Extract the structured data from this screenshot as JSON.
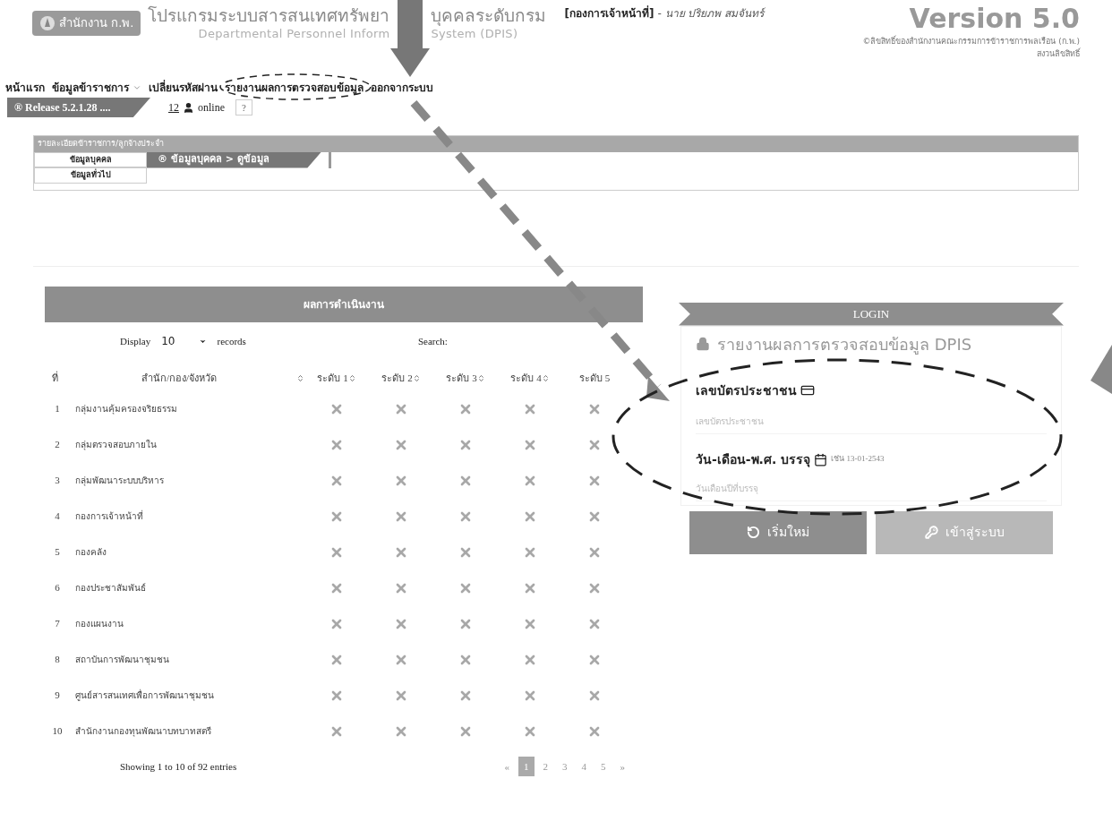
{
  "header": {
    "logo_text": "สำนักงาน ก.พ.",
    "title": [
      "โปรแกรมระบบสารสนเทศทรัพยา",
      "บุคคลระดับกรม"
    ],
    "subtitle": [
      "Departmental Personnel Inform",
      "System (DPIS)"
    ],
    "department": "[กองการเจ้าหน้าที่]",
    "user": "- นาย ปริยภพ สมจันทร์",
    "version": "Version 5.0",
    "copyright": "©ลิขสิทธิ์ของสำนักงานคณะกรรมการข้าราชการพลเรือน (ก.พ.)",
    "rights": "สงวนลิขสิทธิ์"
  },
  "nav": [
    {
      "label": "หน้าแรก",
      "dropdown": false
    },
    {
      "label": "ข้อมูลข้าราชการ",
      "dropdown": true
    },
    {
      "label": "เปลี่ยนรหัสผ่าน",
      "dropdown": false
    },
    {
      "label": "รายงานผลการตรวจสอบข้อมูล",
      "dropdown": false
    },
    {
      "label": "ออกจากระบบ",
      "dropdown": false
    }
  ],
  "release": "® Release 5.2.1.28 ....",
  "online_count": "12",
  "online_label": "online",
  "help": "?",
  "panel": {
    "title": "รายละเอียดข้าราชการ/ลูกจ้างประจำ",
    "menu": [
      "ข้อมูลบุคคล",
      "ข้อมูลทั่วไป"
    ],
    "breadcrumb": "® ข้อมูลบุคคล > ดูข้อมูล"
  },
  "table": {
    "title": "ผลการดำเนินงาน",
    "display_label": "Display",
    "page_size": "10",
    "records_label": "records",
    "search_label": "Search:",
    "columns": [
      {
        "label": "ที่",
        "sortable": false
      },
      {
        "label": "สำนัก/กอง/จังหวัด",
        "sortable": true
      },
      {
        "label": "ระดับ 1",
        "sortable": true
      },
      {
        "label": "ระดับ 2",
        "sortable": true
      },
      {
        "label": "ระดับ 3",
        "sortable": true
      },
      {
        "label": "ระดับ 4",
        "sortable": true
      },
      {
        "label": "ระดับ 5",
        "sortable": false
      }
    ],
    "rows": [
      {
        "no": "1",
        "name": "กลุ่มงานคุ้มครองจริยธรรม",
        "levels": [
          false,
          false,
          false,
          false,
          false
        ]
      },
      {
        "no": "2",
        "name": "กลุ่มตรวจสอบภายใน",
        "levels": [
          false,
          false,
          false,
          false,
          false
        ]
      },
      {
        "no": "3",
        "name": "กลุ่มพัฒนาระบบบริหาร",
        "levels": [
          false,
          false,
          false,
          false,
          false
        ]
      },
      {
        "no": "4",
        "name": "กองการเจ้าหน้าที่",
        "levels": [
          false,
          false,
          false,
          false,
          false
        ]
      },
      {
        "no": "5",
        "name": "กองคลัง",
        "levels": [
          false,
          false,
          false,
          false,
          false
        ]
      },
      {
        "no": "6",
        "name": "กองประชาสัมพันธ์",
        "levels": [
          false,
          false,
          false,
          false,
          false
        ]
      },
      {
        "no": "7",
        "name": "กองแผนงาน",
        "levels": [
          false,
          false,
          false,
          false,
          false
        ]
      },
      {
        "no": "8",
        "name": "สถาบันการพัฒนาชุมชน",
        "levels": [
          false,
          false,
          false,
          false,
          false
        ]
      },
      {
        "no": "9",
        "name": "ศูนย์สารสนเทศเพื่อการพัฒนาชุมชน",
        "levels": [
          false,
          false,
          false,
          false,
          false
        ]
      },
      {
        "no": "10",
        "name": "สำนักงานกองทุนพัฒนาบทบาทสตรี",
        "levels": [
          false,
          false,
          false,
          false,
          false
        ]
      }
    ],
    "info": "Showing 1 to 10 of 92 entries",
    "pagination": [
      {
        "label": "«",
        "selected": false
      },
      {
        "label": "1",
        "selected": true
      },
      {
        "label": "2",
        "selected": false
      },
      {
        "label": "3",
        "selected": false
      },
      {
        "label": "4",
        "selected": false
      },
      {
        "label": "5",
        "selected": false
      },
      {
        "label": "»",
        "selected": false
      }
    ]
  },
  "login": {
    "ribbon": "LOGIN",
    "title": "รายงานผลการตรวจสอบข้อมูล DPIS",
    "id_label": "เลขบัตรประชาชน",
    "id_placeholder": "เลขบัตรประชาชน",
    "date_label": "วัน-เดือน-พ.ศ. บรรจุ",
    "date_hint": "เช่น 13-01-2543",
    "date_placeholder": "วันเดือนปีที่บรรจุ",
    "reset_button": "เริ่มใหม่",
    "login_button": "เข้าสู่ระบบ"
  }
}
